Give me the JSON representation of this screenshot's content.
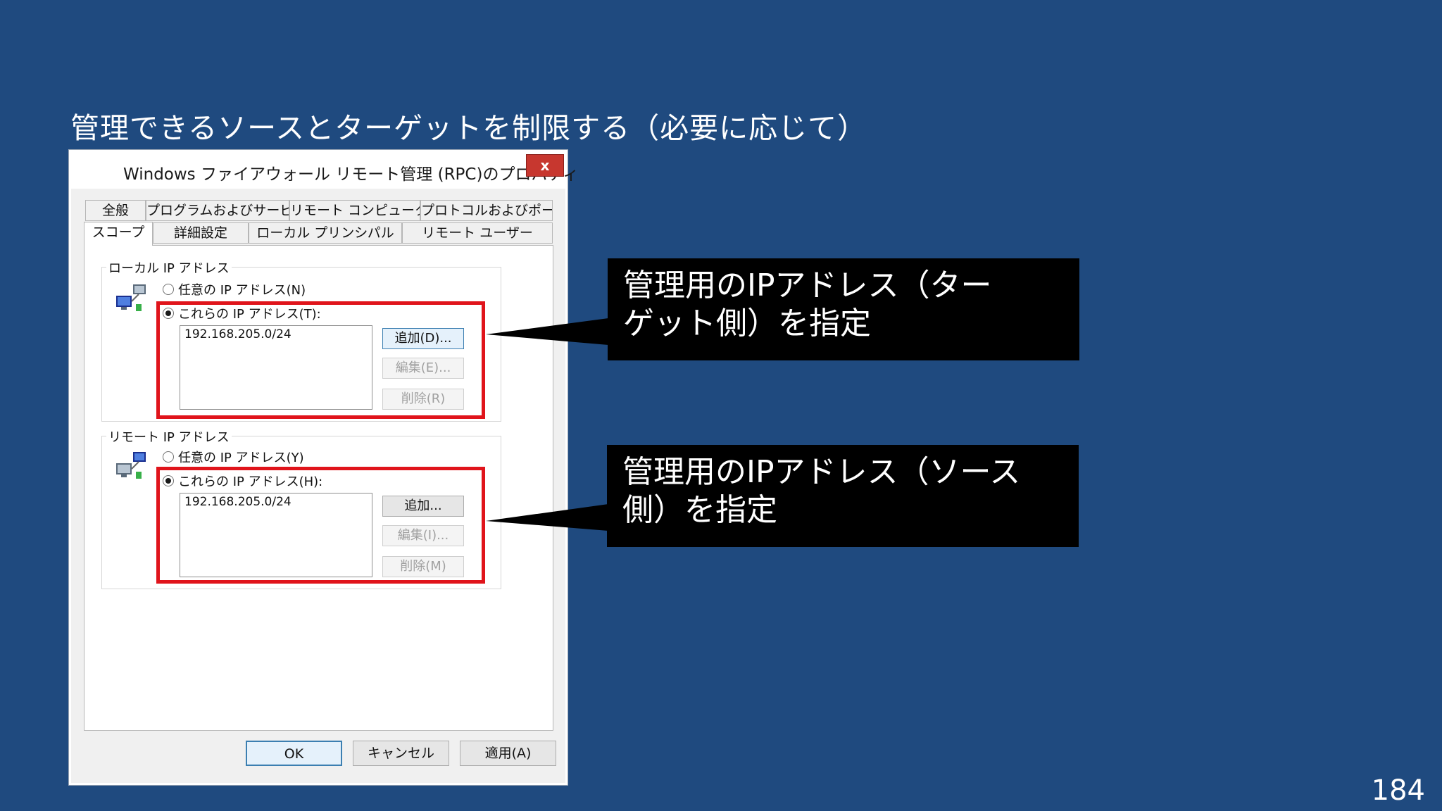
{
  "slide": {
    "title": "管理できるソースとターゲットを制限する（必要に応じて）",
    "page_number": "184"
  },
  "dialog": {
    "title": "Windows ファイアウォール リモート管理 (RPC)のプロパティ",
    "close_label": "x",
    "tabs_row1": [
      "全般",
      "プログラムおよびサービス",
      "リモート コンピューター",
      "プロトコルおよびポート"
    ],
    "tabs_row2": [
      "スコープ",
      "詳細設定",
      "ローカル プリンシパル",
      "リモート ユーザー"
    ],
    "local": {
      "group_label": "ローカル IP アドレス",
      "radio_any": "任意の IP アドレス(N)",
      "radio_these": "これらの IP アドレス(T):",
      "addresses": [
        "192.168.205.0/24"
      ],
      "add_label": "追加(D)...",
      "edit_label": "編集(E)...",
      "delete_label": "削除(R)"
    },
    "remote": {
      "group_label": "リモート IP アドレス",
      "radio_any": "任意の IP アドレス(Y)",
      "radio_these": "これらの IP アドレス(H):",
      "addresses": [
        "192.168.205.0/24"
      ],
      "add_label": "追加...",
      "edit_label": "編集(I)...",
      "delete_label": "削除(M)"
    },
    "ok_label": "OK",
    "cancel_label": "キャンセル",
    "apply_label": "適用(A)"
  },
  "callouts": {
    "target": [
      "管理用のIPアドレス（ター",
      "ゲット側）を指定"
    ],
    "source": [
      "管理用のIPアドレス（ソース",
      "側）を指定"
    ]
  },
  "colors": {
    "background": "#1f4a7f",
    "highlight": "#e0141b",
    "callout": "#000000"
  }
}
